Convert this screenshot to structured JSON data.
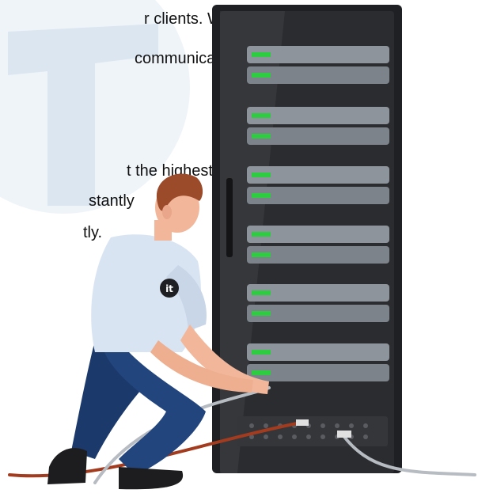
{
  "paragraph_top": {
    "line1": "r clients. We will",
    "line2": " communication."
  },
  "paragraph_bottom": {
    "line1": "t the highest",
    "line2": "stantly",
    "line3": "tly."
  },
  "shirt_logo": "it",
  "colors": {
    "rack_dark": "#2b2c2f",
    "rack_mid": "#3a3b3f",
    "server_face": "#8e949c",
    "led_green": "#2ecc40",
    "shirt": "#d9e4f2",
    "pants": "#1b3a6b",
    "skin": "#f2b79a",
    "hair": "#9b4a2a",
    "watermark": "#dbe6f1",
    "cable_red": "#a33b1f",
    "cable_grey": "#b7bcc2"
  }
}
